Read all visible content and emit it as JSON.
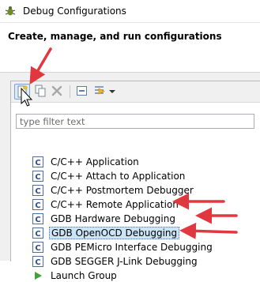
{
  "window": {
    "title": "Debug Configurations"
  },
  "banner": {
    "heading": "Create, manage, and run configurations"
  },
  "filter": {
    "placeholder": "type filter text"
  },
  "tree": {
    "items": [
      {
        "label": "C/C++ Application",
        "icon": "c-config-icon"
      },
      {
        "label": "C/C++ Attach to Application",
        "icon": "c-config-icon"
      },
      {
        "label": "C/C++ Postmortem Debugger",
        "icon": "c-config-icon"
      },
      {
        "label": "C/C++ Remote Application",
        "icon": "c-config-icon"
      },
      {
        "label": "GDB Hardware Debugging",
        "icon": "c-config-icon"
      },
      {
        "label": "GDB OpenOCD Debugging",
        "icon": "c-config-icon",
        "selected": true
      },
      {
        "label": "GDB PEMicro Interface Debugging",
        "icon": "c-config-icon"
      },
      {
        "label": "GDB SEGGER J-Link Debugging",
        "icon": "c-config-icon"
      },
      {
        "label": "Launch Group",
        "icon": "launch-group-icon"
      }
    ]
  },
  "colors": {
    "annotation_arrow": "#e0383e",
    "selection": "#cce4f7"
  }
}
